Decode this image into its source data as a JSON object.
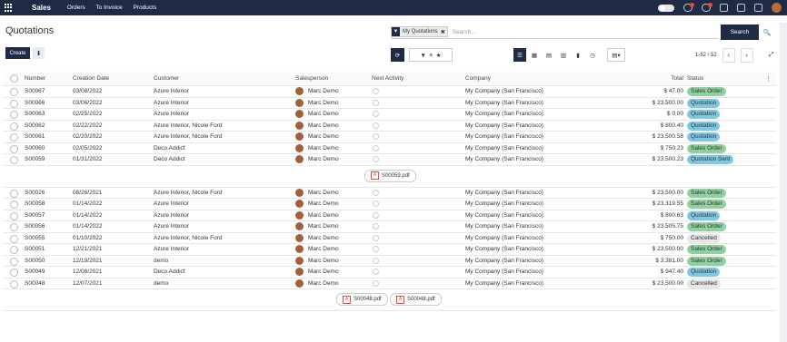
{
  "topbar": {
    "brand": "Sales",
    "menu": [
      "Orders",
      "To Invoice",
      "Products"
    ]
  },
  "page": {
    "title": "Quotations"
  },
  "search": {
    "facet": "My Quotations",
    "placeholder": "Search...",
    "button": "Search"
  },
  "toolbar": {
    "create": "Create",
    "pager": "1-52 / 52"
  },
  "columns": {
    "number": "Number",
    "date": "Creation Date",
    "customer": "Customer",
    "salesperson": "Salesperson",
    "activity": "Next Activity",
    "company": "Company",
    "total": "Total",
    "status": "Status"
  },
  "status_colors": {
    "Sales Order": "#8fd19e",
    "Quotation": "#7ec8e3",
    "Quotation Sent": "#7ec8e3",
    "Cancelled": "#e6e6e6"
  },
  "rows": [
    {
      "number": "S00067",
      "date": "03/08/2022",
      "customer": "Azure Interior",
      "salesperson": "Marc Demo",
      "company": "My Company (San Francisco)",
      "total": "$ 47.00",
      "status": "Sales Order"
    },
    {
      "number": "S00066",
      "date": "03/06/2022",
      "customer": "Azure Interior",
      "salesperson": "Marc Demo",
      "company": "My Company (San Francisco)",
      "total": "$ 23,500.00",
      "status": "Quotation"
    },
    {
      "number": "S00063",
      "date": "02/25/2022",
      "customer": "Azure Interior",
      "salesperson": "Marc Demo",
      "company": "My Company (San Francisco)",
      "total": "$ 0.00",
      "status": "Quotation"
    },
    {
      "number": "S00062",
      "date": "02/22/2022",
      "customer": "Azure Interior, Nicole Ford",
      "salesperson": "Marc Demo",
      "company": "My Company (San Francisco)",
      "total": "$ 800.40",
      "status": "Quotation"
    },
    {
      "number": "S00061",
      "date": "02/20/2022",
      "customer": "Azure Interior, Nicole Ford",
      "salesperson": "Marc Demo",
      "company": "My Company (San Francisco)",
      "total": "$ 23,500.58",
      "status": "Quotation"
    },
    {
      "number": "S00060",
      "date": "02/05/2022",
      "customer": "Deco Addict",
      "salesperson": "Marc Demo",
      "company": "My Company (San Francisco)",
      "total": "$ 750.23",
      "status": "Sales Order"
    },
    {
      "number": "S00059",
      "date": "01/31/2022",
      "customer": "Deco Addict",
      "salesperson": "Marc Demo",
      "company": "My Company (San Francisco)",
      "total": "$ 23,500.23",
      "status": "Quotation Sent",
      "attachments": [
        "S00059.pdf"
      ]
    },
    {
      "number": "S00026",
      "date": "08/26/2021",
      "customer": "Azure Interior, Nicole Ford",
      "salesperson": "Marc Demo",
      "company": "My Company (San Francisco)",
      "total": "$ 23,500.00",
      "status": "Sales Order"
    },
    {
      "number": "S00058",
      "date": "01/14/2022",
      "customer": "Azure Interior",
      "salesperson": "Marc Demo",
      "company": "My Company (San Francisco)",
      "total": "$ 23,319.55",
      "status": "Sales Order"
    },
    {
      "number": "S00057",
      "date": "01/14/2022",
      "customer": "Azure Interior",
      "salesperson": "Marc Demo",
      "company": "My Company (San Francisco)",
      "total": "$ 800.63",
      "status": "Quotation"
    },
    {
      "number": "S00056",
      "date": "01/14/2022",
      "customer": "Azure Interior",
      "salesperson": "Marc Demo",
      "company": "My Company (San Francisco)",
      "total": "$ 23,505.75",
      "status": "Sales Order"
    },
    {
      "number": "S00055",
      "date": "01/10/2022",
      "customer": "Azure Interior, Nicole Ford",
      "salesperson": "Marc Demo",
      "company": "My Company (San Francisco)",
      "total": "$ 750.00",
      "status": "Cancelled"
    },
    {
      "number": "S00051",
      "date": "12/21/2021",
      "customer": "Azure Interior",
      "salesperson": "Marc Demo",
      "company": "My Company (San Francisco)",
      "total": "$ 23,500.00",
      "status": "Sales Order"
    },
    {
      "number": "S00050",
      "date": "12/19/2021",
      "customer": "demo",
      "salesperson": "Marc Demo",
      "company": "My Company (San Francisco)",
      "total": "$ 3,381.00",
      "status": "Sales Order"
    },
    {
      "number": "S00049",
      "date": "12/08/2021",
      "customer": "Deco Addict",
      "salesperson": "Marc Demo",
      "company": "My Company (San Francisco)",
      "total": "$ 947.40",
      "status": "Quotation"
    },
    {
      "number": "S00048",
      "date": "12/07/2021",
      "customer": "demo",
      "salesperson": "Marc Demo",
      "company": "My Company (San Francisco)",
      "total": "$ 23,500.00",
      "status": "Cancelled",
      "attachments": [
        "S00048.pdf",
        "S00048.pdf"
      ]
    }
  ]
}
